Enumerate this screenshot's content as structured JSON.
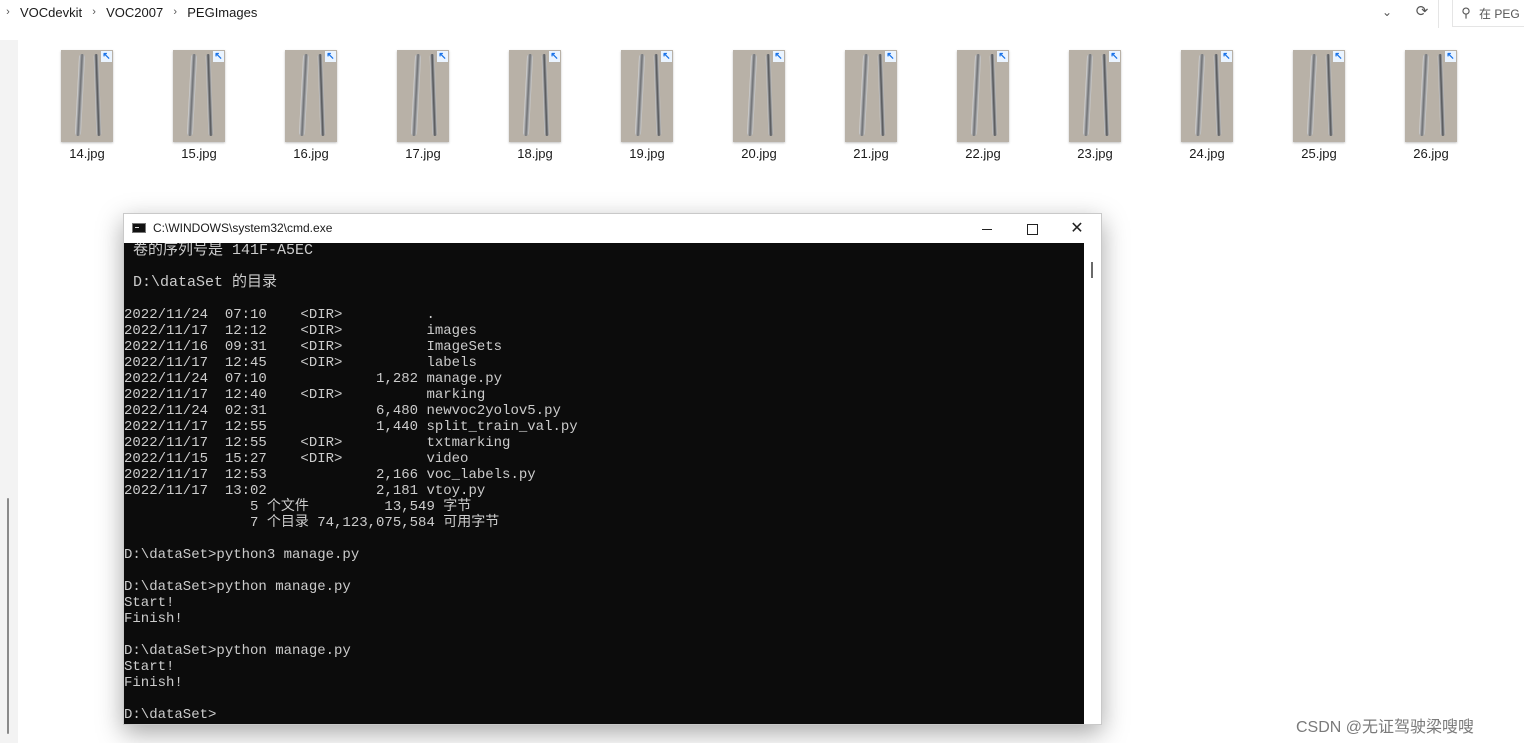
{
  "explorer": {
    "breadcrumb": [
      "VOCdevkit",
      "VOC2007",
      "PEGImages"
    ],
    "search_placeholder": "在 PEG",
    "files": [
      "14.jpg",
      "15.jpg",
      "16.jpg",
      "17.jpg",
      "18.jpg",
      "19.jpg",
      "20.jpg",
      "21.jpg",
      "22.jpg",
      "23.jpg",
      "24.jpg",
      "25.jpg",
      "26.jpg"
    ]
  },
  "cmd": {
    "title": "C:\\WINDOWS\\system32\\cmd.exe",
    "lines": [
      " 卷的序列号是 141F-A5EC",
      "",
      " D:\\dataSet 的目录",
      "",
      "2022/11/24  07:10    <DIR>          .",
      "2022/11/17  12:12    <DIR>          images",
      "2022/11/16  09:31    <DIR>          ImageSets",
      "2022/11/17  12:45    <DIR>          labels",
      "2022/11/24  07:10             1,282 manage.py",
      "2022/11/17  12:40    <DIR>          marking",
      "2022/11/24  02:31             6,480 newvoc2yolov5.py",
      "2022/11/17  12:55             1,440 split_train_val.py",
      "2022/11/17  12:55    <DIR>          txtmarking",
      "2022/11/15  15:27    <DIR>          video",
      "2022/11/17  12:53             2,166 voc_labels.py",
      "2022/11/17  13:02             2,181 vtoy.py",
      "               5 个文件         13,549 字节",
      "               7 个目录 74,123,075,584 可用字节",
      "",
      "D:\\dataSet>python3 manage.py",
      "",
      "D:\\dataSet>python manage.py",
      "Start!",
      "Finish!",
      "",
      "D:\\dataSet>python manage.py",
      "Start!",
      "Finish!",
      "",
      "D:\\dataSet>"
    ]
  },
  "watermark": "CSDN @无证驾驶梁嗖嗖",
  "colors": {
    "console_bg": "#0c0c0c",
    "console_fg": "#cccccc",
    "thumb_badge": "#1a73e8"
  }
}
